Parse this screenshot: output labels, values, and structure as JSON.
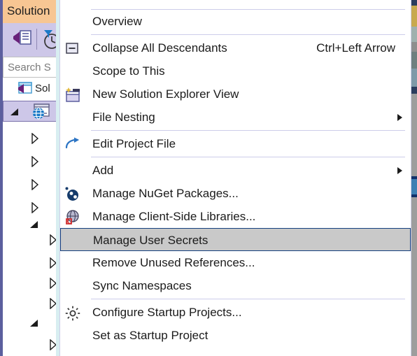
{
  "solution_explorer": {
    "title": "Solution",
    "search": {
      "placeholder": "Search S"
    },
    "solution_node_label": "Sol",
    "toolbar": {
      "icons": [
        "vs-solution-explorer-icon",
        "pending-changes-filter-icon"
      ]
    },
    "tree": {
      "selected_node_icon": "web-project-globe-icon",
      "nodes": [
        {
          "state": "expanded",
          "indent": 0
        },
        {
          "state": "collapsed",
          "indent": 1
        },
        {
          "state": "collapsed",
          "indent": 1
        },
        {
          "state": "collapsed",
          "indent": 1
        },
        {
          "state": "collapsed",
          "indent": 1
        },
        {
          "state": "expanded",
          "indent": 1
        },
        {
          "state": "collapsed",
          "indent": 2
        },
        {
          "state": "collapsed",
          "indent": 2
        },
        {
          "state": "collapsed",
          "indent": 2
        },
        {
          "state": "collapsed",
          "indent": 2
        },
        {
          "state": "expanded",
          "indent": 1
        },
        {
          "state": "collapsed",
          "indent": 2
        }
      ]
    }
  },
  "context_menu": {
    "highlighted_item": "Manage User Secrets",
    "items": [
      {
        "label": "Overview",
        "accel": "",
        "icon": "",
        "submenu": false,
        "highlight": false,
        "sep_after": true
      },
      {
        "label": "Collapse All Descendants",
        "accel": "Ctrl+Left Arrow",
        "icon": "collapse-all-icon",
        "submenu": false,
        "highlight": false,
        "sep_after": false
      },
      {
        "label": "Scope to This",
        "accel": "",
        "icon": "",
        "submenu": false,
        "highlight": false,
        "sep_after": false
      },
      {
        "label": "New Solution Explorer View",
        "accel": "",
        "icon": "new-solution-view-icon",
        "submenu": false,
        "highlight": false,
        "sep_after": false
      },
      {
        "label": "File Nesting",
        "accel": "",
        "icon": "",
        "submenu": true,
        "highlight": false,
        "sep_after": true
      },
      {
        "label": "Edit Project File",
        "accel": "",
        "icon": "edit-project-file-icon",
        "submenu": false,
        "highlight": false,
        "sep_after": true
      },
      {
        "label": "Add",
        "accel": "",
        "icon": "",
        "submenu": true,
        "highlight": false,
        "sep_after": false
      },
      {
        "label": "Manage NuGet Packages...",
        "accel": "",
        "icon": "nuget-icon",
        "submenu": false,
        "highlight": false,
        "sep_after": false
      },
      {
        "label": "Manage Client-Side Libraries...",
        "accel": "",
        "icon": "client-side-libraries-icon",
        "submenu": false,
        "highlight": false,
        "sep_after": false
      },
      {
        "label": "Manage User Secrets",
        "accel": "",
        "icon": "",
        "submenu": false,
        "highlight": true,
        "sep_after": false
      },
      {
        "label": "Remove Unused References...",
        "accel": "",
        "icon": "",
        "submenu": false,
        "highlight": false,
        "sep_after": false
      },
      {
        "label": "Sync Namespaces",
        "accel": "",
        "icon": "",
        "submenu": false,
        "highlight": false,
        "sep_after": true
      },
      {
        "label": "Configure Startup Projects...",
        "accel": "",
        "icon": "gear-icon",
        "submenu": false,
        "highlight": false,
        "sep_after": false
      },
      {
        "label": "Set as Startup Project",
        "accel": "",
        "icon": "",
        "submenu": false,
        "highlight": false,
        "sep_after": false
      }
    ]
  },
  "colors": {
    "highlight_fill": "#c9c9c9",
    "highlight_border": "#14407e",
    "separator": "#ccccea",
    "panel_header": "#f7c693",
    "panel_toolbar": "#cdc7e8",
    "tree_selection": "#cdc7e8",
    "menu_text": "#1b1b1b"
  }
}
